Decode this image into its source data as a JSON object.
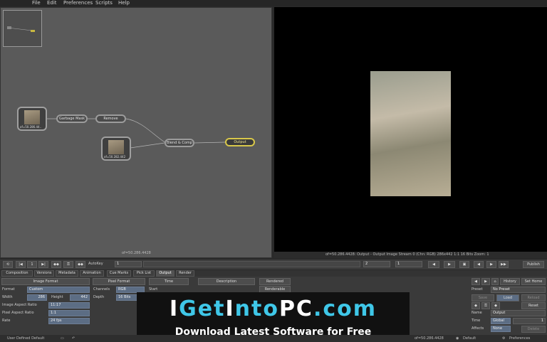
{
  "menu": [
    "File",
    "Edit",
    "Preferences",
    "Scripts",
    "Help"
  ],
  "nodes": {
    "garbage_mask": "Garbage Mask",
    "remove": "Remove",
    "blend_comp": "Blend & Comp",
    "output": "Output",
    "src1": "of=50.286.44..",
    "src2": "of=50.282.442"
  },
  "nodeview_status": "of=50.286.4428",
  "viewer_status": "of=50.286.4428: Output - Output Image  Stream 0 (Chn: RGB)  286x442  1:1  16 Bits  Zoom: 1",
  "timebar": {
    "autokey": "AutoKey",
    "frame_start": "1",
    "frame_cur": "2",
    "frame_end": "1",
    "publish": "Publish"
  },
  "tabs": [
    "Composition",
    "Versions",
    "Metadata",
    "Animation",
    "Cue Marks",
    "Pick List",
    "Output",
    "Render"
  ],
  "props": {
    "image_format_hdr": "Image Format",
    "pixel_format_hdr": "Pixel Format",
    "time_hdr": "Time",
    "description_hdr": "Description",
    "rendered_hdr": "Rendered",
    "renderable": "Renderable",
    "format_label": "Format",
    "format_value": "Custom",
    "channels_label": "Channels",
    "channels_value": "RGB",
    "start_label": "Start",
    "width_label": "Width",
    "width_value": "286",
    "height_label": "Height",
    "height_value": "442",
    "depth_label": "Depth",
    "depth_value": "16 Bits",
    "iar_label": "Image Aspect Ratio",
    "iar_value": "11:17",
    "par_label": "Pixel Aspect Ratio",
    "par_value": "1:1",
    "rate_label": "Rate",
    "rate_value": "24 fps"
  },
  "right_panel": {
    "history": "History",
    "set_home": "Set Home",
    "preset_label": "Preset",
    "preset_value": "No Preset",
    "save": "Save",
    "load": "Load",
    "reload": "Reload",
    "reset": "Reset",
    "name_label": "Name",
    "name_value": "Output",
    "time_label": "Time",
    "time_value": "Global",
    "time_num": "1",
    "affects_label": "Affects",
    "affects_value": "None",
    "delete": "Delete"
  },
  "banner": {
    "line1a": "I",
    "line1b": "Get",
    "line1c": "I",
    "line1d": "nto",
    "line1e": "PC",
    "line1f": ".com",
    "line2": "Download Latest Software for Free"
  },
  "bottom": {
    "left": "User Defined Default",
    "mid": "of=50.286.4428",
    "default": "Default",
    "prefs": "Preferences"
  }
}
